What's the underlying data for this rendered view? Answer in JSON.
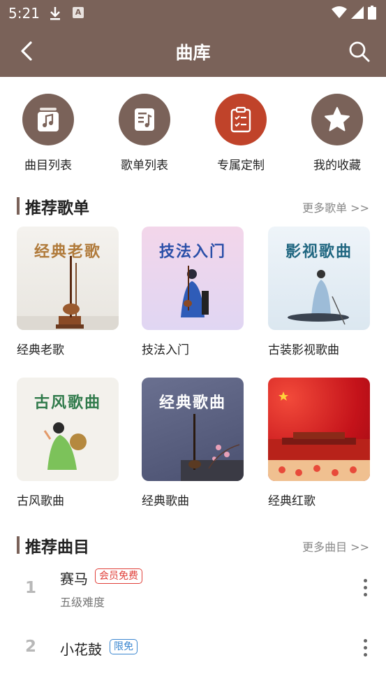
{
  "status_bar": {
    "time": "5:21",
    "a_icon_letter": "A"
  },
  "app_bar": {
    "title": "曲库"
  },
  "quick_actions": [
    {
      "label": "曲目列表",
      "icon": "music-note-icon"
    },
    {
      "label": "歌单列表",
      "icon": "playlist-icon"
    },
    {
      "label": "专属定制",
      "icon": "clipboard-check-icon"
    },
    {
      "label": "我的收藏",
      "icon": "star-icon"
    }
  ],
  "playlists_section": {
    "title": "推荐歌单",
    "more": "更多歌单 >>"
  },
  "playlists": [
    {
      "name": "经典老歌",
      "cover_text": "经典老歌"
    },
    {
      "name": "技法入门",
      "cover_text": "技法入门"
    },
    {
      "name": "古装影视歌曲",
      "cover_text": "影视歌曲"
    },
    {
      "name": "古风歌曲",
      "cover_text": "古风歌曲"
    },
    {
      "name": "经典歌曲",
      "cover_text": "经典歌曲"
    },
    {
      "name": "经典红歌",
      "cover_text": ""
    }
  ],
  "songs_section": {
    "title": "推荐曲目",
    "more": "更多曲目 >>"
  },
  "songs": [
    {
      "index": "1",
      "name": "赛马",
      "tag": "会员免费",
      "subtitle": "五级难度"
    },
    {
      "index": "2",
      "name": "小花鼓",
      "tag": "限免",
      "subtitle": ""
    }
  ],
  "colors": {
    "brand": "#7a6259",
    "accent_red": "#c0432a",
    "vip_tag": "#e0403a",
    "free_tag": "#3a86d0"
  }
}
